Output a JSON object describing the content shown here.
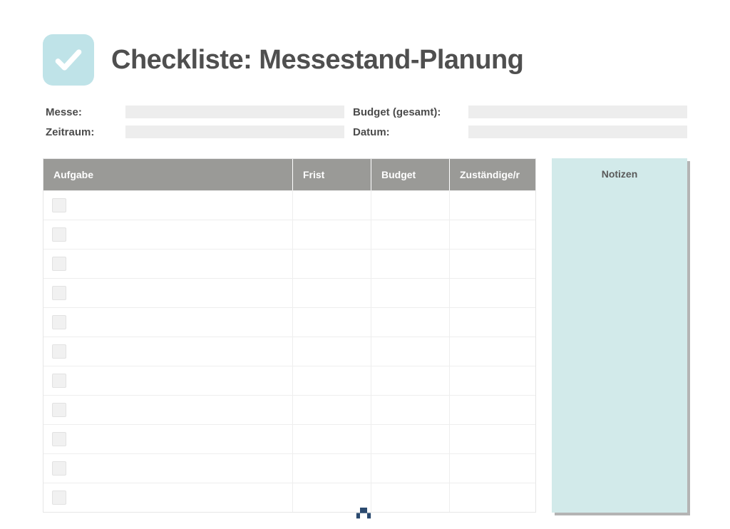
{
  "header": {
    "title": "Checkliste: Messestand-Planung",
    "icon": "check-icon"
  },
  "meta": {
    "field1_label": "Messe:",
    "field1_value": "",
    "field2_label": "Budget (gesamt):",
    "field2_value": "",
    "field3_label": "Zeitraum:",
    "field3_value": "",
    "field4_label": "Datum:",
    "field4_value": ""
  },
  "table": {
    "columns": [
      "Aufgabe",
      "Frist",
      "Budget",
      "Zuständige/r"
    ],
    "rows": [
      {
        "checked": false,
        "aufgabe": "",
        "frist": "",
        "budget": "",
        "zustaendig": ""
      },
      {
        "checked": false,
        "aufgabe": "",
        "frist": "",
        "budget": "",
        "zustaendig": ""
      },
      {
        "checked": false,
        "aufgabe": "",
        "frist": "",
        "budget": "",
        "zustaendig": ""
      },
      {
        "checked": false,
        "aufgabe": "",
        "frist": "",
        "budget": "",
        "zustaendig": ""
      },
      {
        "checked": false,
        "aufgabe": "",
        "frist": "",
        "budget": "",
        "zustaendig": ""
      },
      {
        "checked": false,
        "aufgabe": "",
        "frist": "",
        "budget": "",
        "zustaendig": ""
      },
      {
        "checked": false,
        "aufgabe": "",
        "frist": "",
        "budget": "",
        "zustaendig": ""
      },
      {
        "checked": false,
        "aufgabe": "",
        "frist": "",
        "budget": "",
        "zustaendig": ""
      },
      {
        "checked": false,
        "aufgabe": "",
        "frist": "",
        "budget": "",
        "zustaendig": ""
      },
      {
        "checked": false,
        "aufgabe": "",
        "frist": "",
        "budget": "",
        "zustaendig": ""
      },
      {
        "checked": false,
        "aufgabe": "",
        "frist": "",
        "budget": "",
        "zustaendig": ""
      }
    ]
  },
  "notes": {
    "title": "Notizen",
    "content": ""
  },
  "footer": {
    "brand": ""
  },
  "colors": {
    "badge_bg": "#bfe3e8",
    "header_bg": "#9a9a97",
    "notes_bg": "#d2eaea",
    "title_color": "#4f4f4f"
  }
}
